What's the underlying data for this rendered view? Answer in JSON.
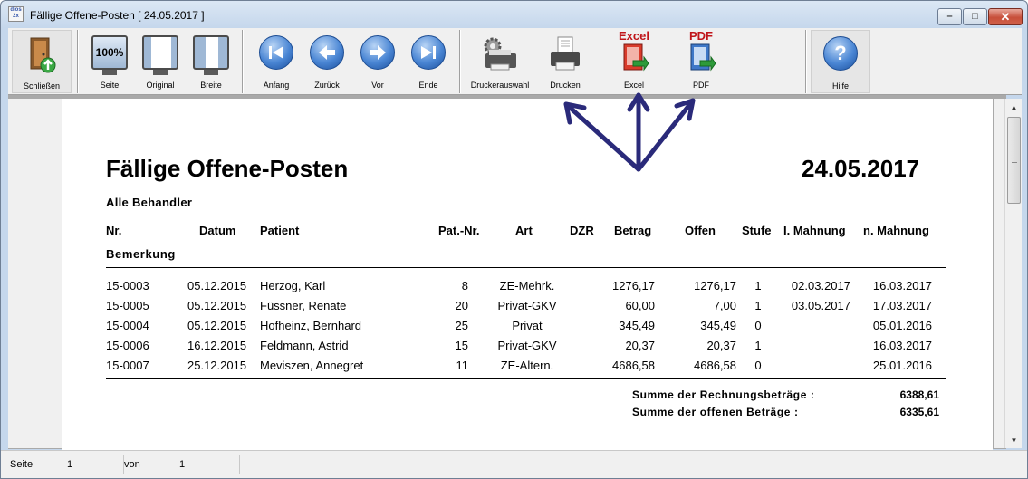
{
  "window": {
    "app_icon_text": "dios 2x",
    "title": "Fällige Offene-Posten [ 24.05.2017 ]"
  },
  "toolbar": {
    "buttons": [
      {
        "label": "Schließen"
      },
      {
        "label": "Seite"
      },
      {
        "label": "Original"
      },
      {
        "label": "Breite"
      },
      {
        "label": "Anfang"
      },
      {
        "label": "Zurück"
      },
      {
        "label": "Vor"
      },
      {
        "label": "Ende"
      },
      {
        "label": "Druckerauswahl"
      },
      {
        "label": "Drucken"
      },
      {
        "label": "Excel"
      },
      {
        "label": "PDF"
      },
      {
        "label": "Hilfe"
      }
    ],
    "zoom_icon_text": "100%",
    "excel_badge": "Excel",
    "pdf_badge": "PDF"
  },
  "colors": {
    "excel_red": "#c0151a",
    "pdf_red": "#c0151a",
    "annotation_arrow": "#2a2a7a",
    "nav_blue": "#4a86d4"
  },
  "report": {
    "title": "Fällige Offene-Posten",
    "date": "24.05.2017",
    "subtitle": "Alle Behandler",
    "columns": [
      "Nr.",
      "Datum",
      "Patient",
      "Pat.-Nr.",
      "Art",
      "DZR",
      "Betrag",
      "Offen",
      "Stufe",
      "I. Mahnung",
      "n. Mahnung"
    ],
    "second_header": "Bemerkung",
    "rows": [
      [
        "15-0003",
        "05.12.2015",
        "Herzog, Karl",
        "8",
        "ZE-Mehrk.",
        "",
        "1276,17",
        "1276,17",
        "1",
        "02.03.2017",
        "16.03.2017"
      ],
      [
        "15-0005",
        "05.12.2015",
        "Füssner, Renate",
        "20",
        "Privat-GKV",
        "",
        "60,00",
        "7,00",
        "1",
        "03.05.2017",
        "17.03.2017"
      ],
      [
        "15-0004",
        "05.12.2015",
        "Hofheinz, Bernhard",
        "25",
        "Privat",
        "",
        "345,49",
        "345,49",
        "0",
        "",
        "05.01.2016"
      ],
      [
        "15-0006",
        "16.12.2015",
        "Feldmann, Astrid",
        "15",
        "Privat-GKV",
        "",
        "20,37",
        "20,37",
        "1",
        "",
        "16.03.2017"
      ],
      [
        "15-0007",
        "25.12.2015",
        "Meviszen, Annegret",
        "11",
        "ZE-Altern.",
        "",
        "4686,58",
        "4686,58",
        "0",
        "",
        "25.01.2016"
      ]
    ],
    "sum_invoice_label": "Summe der Rechnungsbeträge :",
    "sum_invoice_value": "6388,61",
    "sum_open_label": "Summe der offenen Beträge :",
    "sum_open_value": "6335,61"
  },
  "statusbar": {
    "page_label": "Seite",
    "page_value": "1",
    "of_label": "von",
    "of_value": "1"
  }
}
